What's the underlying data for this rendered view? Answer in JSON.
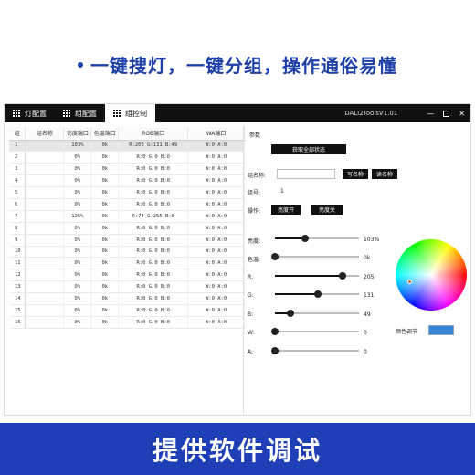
{
  "headline": "一键搜灯，一键分组，操作通俗易懂",
  "tabs": [
    {
      "label": "灯配置"
    },
    {
      "label": "组配置"
    },
    {
      "label": "组控制"
    }
  ],
  "window_title": "DALI2ToolsV1.01",
  "window_controls": {
    "minimize": "—",
    "maximize": "",
    "close": "✕"
  },
  "table": {
    "headers": [
      "组",
      "组名称",
      "亮度端口",
      "色温端口",
      "RGB端口",
      "WA端口"
    ],
    "selected_row": 1,
    "rows": [
      [
        "1",
        "",
        "103%",
        "0k",
        "R:205 G:131 B:49",
        "W:0 A:0"
      ],
      [
        "2",
        "",
        "0%",
        "0k",
        "R:0 G:0 B:0",
        "W:0 A:0"
      ],
      [
        "3",
        "",
        "0%",
        "0k",
        "R:0 G:0 B:0",
        "W:0 A:0"
      ],
      [
        "4",
        "",
        "0%",
        "0k",
        "R:0 G:0 B:0",
        "W:0 A:0"
      ],
      [
        "5",
        "",
        "0%",
        "0k",
        "R:0 G:0 B:0",
        "W:0 A:0"
      ],
      [
        "6",
        "",
        "0%",
        "0k",
        "R:0 G:0 B:0",
        "W:0 A:0"
      ],
      [
        "7",
        "",
        "125%",
        "0k",
        "R:74 G:255 B:0",
        "W:0 A:0"
      ],
      [
        "8",
        "",
        "0%",
        "0k",
        "R:0 G:0 B:0",
        "W:0 A:0"
      ],
      [
        "9",
        "",
        "0%",
        "0k",
        "R:0 G:0 B:0",
        "W:0 A:0"
      ],
      [
        "10",
        "",
        "0%",
        "0k",
        "R:0 G:0 B:0",
        "W:0 A:0"
      ],
      [
        "11",
        "",
        "0%",
        "0k",
        "R:0 G:0 B:0",
        "W:0 A:0"
      ],
      [
        "12",
        "",
        "0%",
        "0k",
        "R:0 G:0 B:0",
        "W:0 A:0"
      ],
      [
        "13",
        "",
        "0%",
        "0k",
        "R:0 G:0 B:0",
        "W:0 A:0"
      ],
      [
        "14",
        "",
        "0%",
        "0k",
        "R:0 G:0 B:0",
        "W:0 A:0"
      ],
      [
        "15",
        "",
        "0%",
        "0k",
        "R:0 G:0 B:0",
        "W:0 A:0"
      ],
      [
        "16",
        "",
        "0%",
        "0k",
        "R:0 G:0 B:0",
        "W:0 A:0"
      ]
    ]
  },
  "panel": {
    "title": "参数",
    "get_all_status": "获取全部状态",
    "group_name_label": "组名称:",
    "group_name_value": "",
    "write_name": "写名称",
    "read_name": "读名称",
    "group_no_label": "组号:",
    "group_no_value": "1",
    "operation_label": "操作:",
    "brightness_on": "亮度开",
    "brightness_off": "亮度关",
    "sliders": [
      {
        "key": "brightness",
        "label": "亮度:",
        "value": "103%",
        "fraction": 0.36
      },
      {
        "key": "color_temp",
        "label": "色温:",
        "value": "0k",
        "fraction": 0.0
      },
      {
        "key": "r",
        "label": "R:",
        "value": "205",
        "fraction": 0.8
      },
      {
        "key": "g",
        "label": "G:",
        "value": "131",
        "fraction": 0.51
      },
      {
        "key": "b",
        "label": "B:",
        "value": "49",
        "fraction": 0.19
      },
      {
        "key": "w",
        "label": "W:",
        "value": "0",
        "fraction": 0.0
      },
      {
        "key": "a",
        "label": "A:",
        "value": "0",
        "fraction": 0.0
      }
    ],
    "color_adjust_label": "颜色调节",
    "swatch_color": "#3a86d6"
  },
  "banner": "提供软件调试",
  "colors": {
    "headline": "#1c3fa8",
    "banner_bg": "#1f3fb6",
    "titlebar": "#111111"
  }
}
